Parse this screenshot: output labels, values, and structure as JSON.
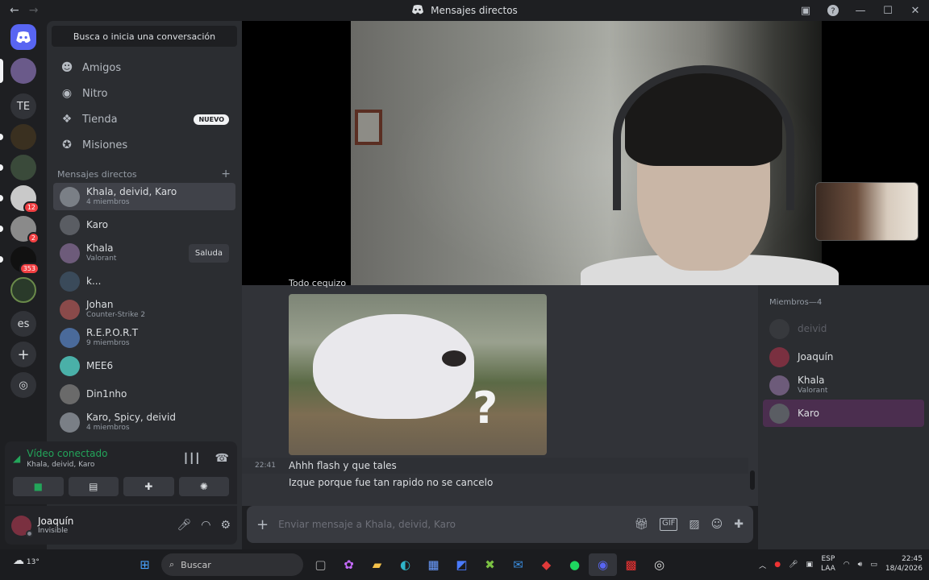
{
  "window": {
    "title": "Mensajes directos",
    "back_arrow": "←",
    "forward_arrow": "→"
  },
  "servers": [
    {
      "name": "discord-home",
      "label": ""
    },
    {
      "name": "server-avatar-1",
      "label": ""
    },
    {
      "name": "server-te",
      "label": "TE"
    },
    {
      "name": "server-4",
      "label": ""
    },
    {
      "name": "server-5",
      "label": ""
    },
    {
      "name": "server-6",
      "label": "",
      "badge": "12"
    },
    {
      "name": "server-7",
      "label": "",
      "badge": "2"
    },
    {
      "name": "server-8",
      "label": "",
      "badge": "353"
    },
    {
      "name": "server-9",
      "label": ""
    },
    {
      "name": "server-es",
      "label": "es"
    }
  ],
  "sidebar": {
    "search_label": "Busca o inicia una conversación",
    "nav": [
      {
        "label": "Amigos",
        "icon": "friends-icon"
      },
      {
        "label": "Nitro",
        "icon": "nitro-icon"
      },
      {
        "label": "Tienda",
        "icon": "shop-icon",
        "tag": "NUEVO"
      },
      {
        "label": "Misiones",
        "icon": "quests-icon"
      }
    ],
    "dm_header": "Mensajes directos",
    "dms": [
      {
        "name": "Khala, deivid, Karo",
        "sub": "4 miembros",
        "active": true,
        "color": "#7a7f86"
      },
      {
        "name": "Karo",
        "sub": "",
        "color": "#5a5d63"
      },
      {
        "name": "Khala",
        "sub": "Valorant",
        "color": "#6d5b7a",
        "action": "Saluda"
      },
      {
        "name": "k...",
        "sub": "",
        "color": "#3a4a5a"
      },
      {
        "name": "Johan",
        "sub": "Counter-Strike 2",
        "color": "#8a4a4a"
      },
      {
        "name": "R.E.P.O.R.T",
        "sub": "9 miembros",
        "color": "#4a6a9a"
      },
      {
        "name": "MEE6",
        "sub": "",
        "color": "#4ab0a8"
      },
      {
        "name": "Din1nho",
        "sub": "",
        "color": "#6a6a6a"
      },
      {
        "name": "Karo, Spicy, deivid",
        "sub": "4 miembros",
        "color": "#7a7f86"
      }
    ]
  },
  "voice": {
    "title": "Vídeo conectado",
    "subtitle": "Khala, deivid, Karo"
  },
  "user": {
    "name": "Joaquín",
    "status": "Invisible"
  },
  "chat": {
    "cut_text": "Todo cequizo",
    "messages": [
      {
        "time": "22:41",
        "text": "Ahhh flash y que tales"
      },
      {
        "time": "",
        "text": "Izque porque fue tan rapido no se cancelo"
      }
    ],
    "image_overlay": "?",
    "composer_placeholder": "Enviar mensaje a Khala, deivid, Karo"
  },
  "members": {
    "header": "Miembros—4",
    "list": [
      {
        "name": "deivid",
        "sub": "",
        "dim": true,
        "color": "#4a4b50"
      },
      {
        "name": "Joaquín",
        "sub": "",
        "dim": false,
        "color": "#7a3040"
      },
      {
        "name": "Khala",
        "sub": "Valorant",
        "dim": false,
        "color": "#6d5b7a"
      },
      {
        "name": "Karo",
        "sub": "",
        "dim": false,
        "color": "#5a5d63",
        "hover": true
      }
    ]
  },
  "taskbar": {
    "temperature": "13°",
    "search": "Buscar",
    "lang_1": "ESP",
    "lang_2": "LAA",
    "time": "22:45",
    "date": "18/4/2026"
  },
  "colors": {
    "accent": "#5865f2",
    "online": "#23a55a",
    "dnd": "#f23f42"
  }
}
